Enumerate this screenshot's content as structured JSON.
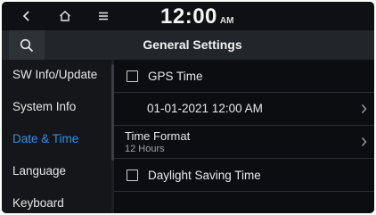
{
  "status": {
    "time": "12:00",
    "ampm": "AM"
  },
  "header": {
    "title": "General Settings"
  },
  "sidebar": {
    "items": [
      {
        "label": "SW Info/Update"
      },
      {
        "label": "System Info"
      },
      {
        "label": "Date & Time",
        "active": true
      },
      {
        "label": "Language"
      },
      {
        "label": "Keyboard"
      }
    ]
  },
  "settings": {
    "gps_time": {
      "label": "GPS Time",
      "checked": false
    },
    "datetime": {
      "value": "01-01-2021 12:00 AM"
    },
    "time_format": {
      "title": "Time Format",
      "value": "12 Hours"
    },
    "daylight": {
      "label": "Daylight Saving Time",
      "checked": false
    }
  },
  "colors": {
    "accent": "#2f90e8",
    "background": "#0b0d11",
    "titlebar": "#22252a",
    "sidebar": "#14161a"
  },
  "icons": {
    "back": "chevron-left-icon",
    "home": "home-icon",
    "menu": "menu-icon",
    "search": "search-icon",
    "row_arrow": "chevron-right-icon"
  }
}
